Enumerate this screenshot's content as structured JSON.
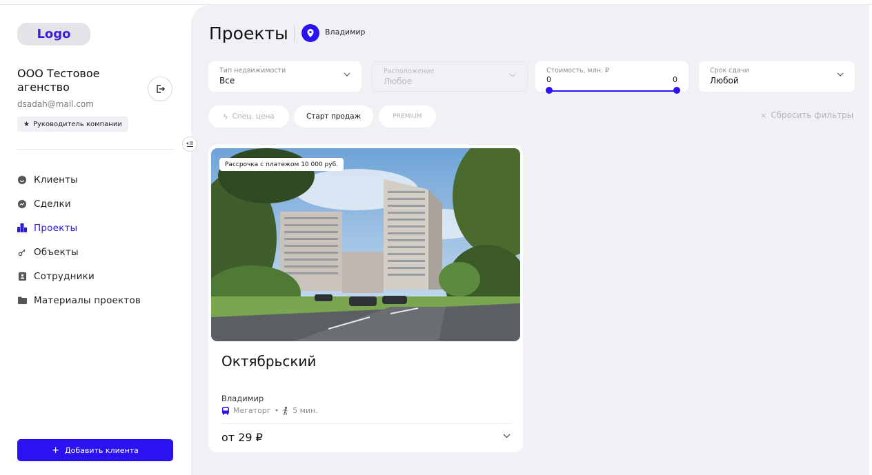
{
  "sidebar": {
    "logo": "Logo",
    "agency_name": "ООО Тестовое агенство",
    "email": "dsadah@mail.com",
    "role": "Руководитель компании",
    "nav": [
      {
        "label": "Клиенты",
        "icon": "clients-icon"
      },
      {
        "label": "Сделки",
        "icon": "deals-icon"
      },
      {
        "label": "Проекты",
        "icon": "projects-icon",
        "active": true
      },
      {
        "label": "Объекты",
        "icon": "key-icon"
      },
      {
        "label": "Сотрудники",
        "icon": "badge-icon"
      },
      {
        "label": "Материалы проектов",
        "icon": "folder-icon"
      }
    ],
    "add_client": "Добавить клиента"
  },
  "header": {
    "title": "Проекты",
    "city": "Владимир"
  },
  "filters": {
    "type": {
      "label": "Тип недвижимости",
      "value": "Все"
    },
    "location": {
      "label": "Расположение",
      "value": "Любое"
    },
    "price": {
      "label": "Стоимость, млн. ₽",
      "min": "0",
      "max": "0"
    },
    "deadline": {
      "label": "Срок сдачи",
      "value": "Любой"
    }
  },
  "chips": {
    "special": "Спец. цена",
    "sale_start": "Старт продаж",
    "premium": "PREMIUM",
    "reset": "Сбросить фильтры"
  },
  "card": {
    "badge": "Рассрочка с платежом 10 000 руб.",
    "title": "Октябрьский",
    "city": "Владимир",
    "metro": "Мегаторг",
    "distance": "5 мин.",
    "price": "от 29 ₽"
  },
  "colors": {
    "accent": "#2b12f0",
    "background": "#f0f1f5"
  }
}
